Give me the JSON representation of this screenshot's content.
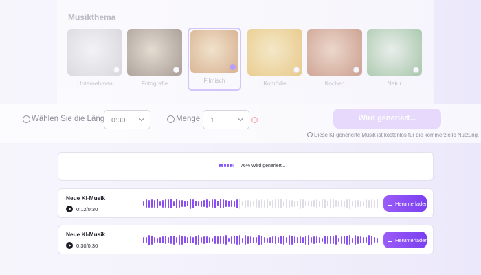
{
  "theme": {
    "title": "Musikthema",
    "items": [
      {
        "label": "Unternehmen",
        "thumb_a": "#c9c9c9",
        "thumb_b": "#f2f2f2",
        "selected": false
      },
      {
        "label": "Fotografie",
        "thumb_a": "#7a6a55",
        "thumb_b": "#d8c9b0",
        "selected": false
      },
      {
        "label": "Filmisch",
        "thumb_a": "#c98a4a",
        "thumb_b": "#f0d7a6",
        "selected": true
      },
      {
        "label": "Komödie",
        "thumb_a": "#e5b340",
        "thumb_b": "#f7e3a0",
        "selected": false
      },
      {
        "label": "Kochen",
        "thumb_a": "#b8704a",
        "thumb_b": "#e9c6a5",
        "selected": false
      },
      {
        "label": "Natur",
        "thumb_a": "#7fb57a",
        "thumb_b": "#e6f1e0",
        "selected": false
      }
    ]
  },
  "controls": {
    "length_label": "Wählen Sie die Länge",
    "length_value": "0:30",
    "amount_label": "Menge",
    "amount_value": "1",
    "generate_label": "Wird generiert...",
    "license_note": "Diese KI-generierte Musik ist kostenlos für die kommerzielle Nutzung."
  },
  "progress": {
    "text": "76% Wird generiert...",
    "percent": 76
  },
  "tracks": [
    {
      "title": "Neue KI-Musik",
      "time": "0:12/0:30",
      "played_fraction": 0.4,
      "download_label": "Herunterladen"
    },
    {
      "title": "Neue KI-Musik",
      "time": "0:30/0:30",
      "played_fraction": 1.0,
      "download_label": "Herunterladen"
    }
  ],
  "colors": {
    "accent": "#8a5cf5",
    "wave_played": "#8a4ff0",
    "wave_unplayed": "#dedde6"
  }
}
